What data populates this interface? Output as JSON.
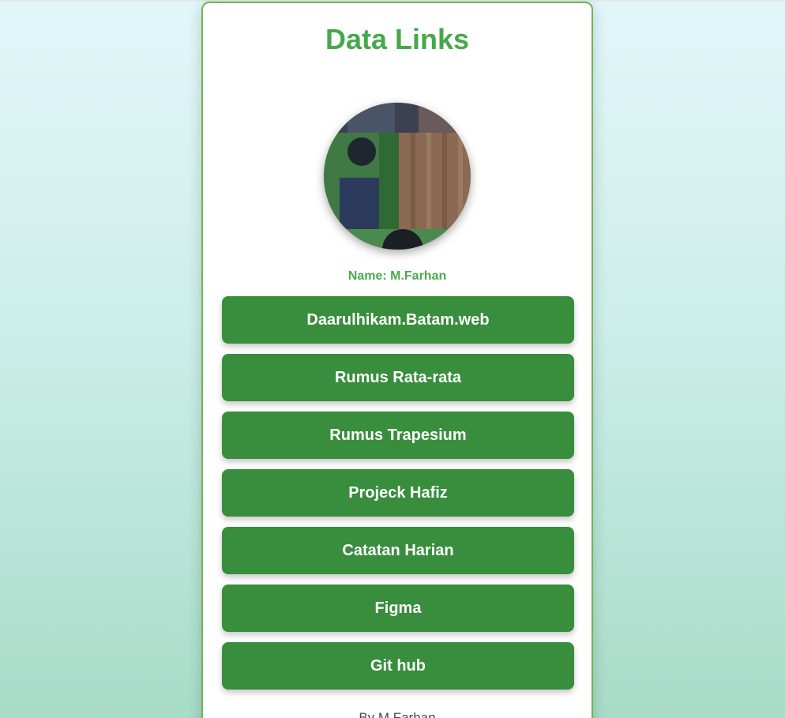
{
  "page": {
    "title": "Data Links",
    "name_label": "Name: M.Farhan",
    "footer": "By M.Farhan"
  },
  "colors": {
    "accent": "#46a84a",
    "button": "#388e3c",
    "button_text": "#ffffff",
    "card_border": "#6fb64f"
  },
  "links": [
    {
      "label": "Daarulhikam.Batam.web"
    },
    {
      "label": "Rumus Rata-rata"
    },
    {
      "label": "Rumus Trapesium"
    },
    {
      "label": "Projeck Hafiz"
    },
    {
      "label": "Catatan Harian"
    },
    {
      "label": "Figma"
    },
    {
      "label": "Git hub"
    }
  ]
}
